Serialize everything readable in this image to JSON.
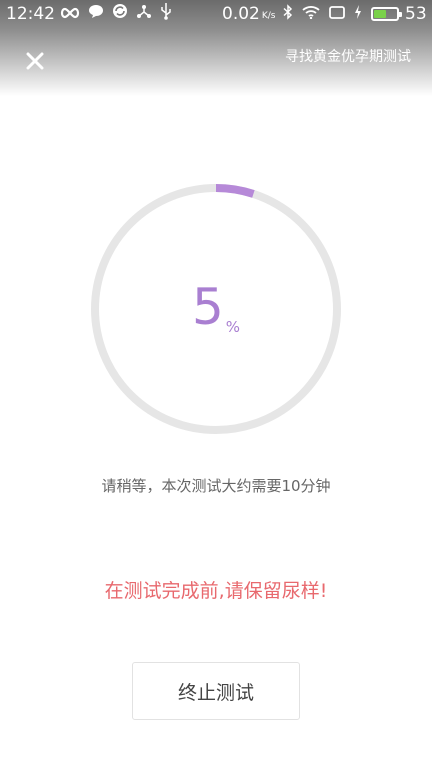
{
  "status_bar": {
    "time": "12:42",
    "speed": "0.02",
    "speed_unit": "K/s",
    "battery_level": "53",
    "battery_fill": 0.53,
    "icons_left": [
      "infinity-icon",
      "chat-bubble-icon",
      "sync-app-icon",
      "share-icon",
      "usb-icon"
    ],
    "icons_right": [
      "bluetooth-icon",
      "wifi-icon",
      "screen-icon",
      "charging-icon",
      "battery-icon"
    ]
  },
  "header": {
    "title": "寻找黄金优孕期测试",
    "close_icon": "close-icon"
  },
  "progress": {
    "value": "5",
    "unit": "%",
    "fraction": 0.05,
    "track_color": "#e6e6e6",
    "fill_color": "#b689d8"
  },
  "messages": {
    "wait": "请稍等，本次测试大约需要10分钟",
    "warning": "在测试完成前,请保留尿样!"
  },
  "actions": {
    "stop_label": "终止测试"
  },
  "colors": {
    "accent": "#a97fd1",
    "warning": "#e8696e"
  }
}
